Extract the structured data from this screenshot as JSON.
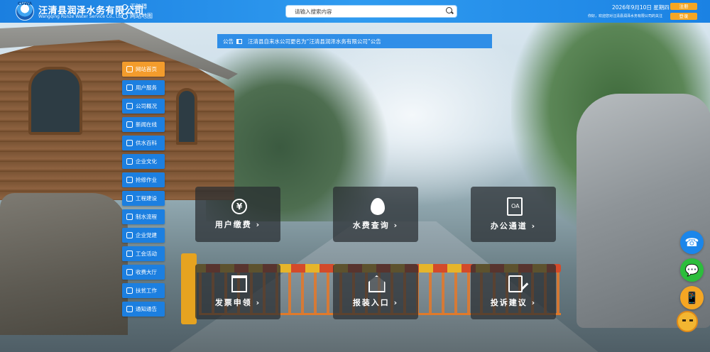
{
  "header": {
    "logo_text": "CUWA",
    "company_cn": "汪清县润泽水务有限公司",
    "company_en": "Wangqing Runze Water Service Co., Ltd",
    "link_accessible": "无障碍",
    "link_sitemap": "网站地图",
    "search_placeholder": "请输入搜索内容",
    "date": "2026年9月10日 星期四",
    "greeting": "你好，欢迎您对汪清县润泽水务有限公司的关注",
    "register_label": "注册",
    "login_label": "登录"
  },
  "notice": {
    "label": "公告",
    "text": "汪清县自来水公司更名为“汪清县润泽水务有限公司”公告"
  },
  "menu": [
    {
      "label": "网站首页",
      "active": true
    },
    {
      "label": "用户服务",
      "active": false
    },
    {
      "label": "公司概况",
      "active": false
    },
    {
      "label": "新闻在线",
      "active": false
    },
    {
      "label": "供水百科",
      "active": false
    },
    {
      "label": "企业文化",
      "active": false
    },
    {
      "label": "抢修作业",
      "active": false
    },
    {
      "label": "工程建设",
      "active": false
    },
    {
      "label": "制水流程",
      "active": false
    },
    {
      "label": "企业党建",
      "active": false
    },
    {
      "label": "工会活动",
      "active": false
    },
    {
      "label": "收费大厅",
      "active": false
    },
    {
      "label": "扶贫工作",
      "active": false
    },
    {
      "label": "通知通告",
      "active": false
    }
  ],
  "tiles": [
    {
      "label": "用户缴费 ›",
      "icon": "payment-coin-icon"
    },
    {
      "label": "水费查询 ›",
      "icon": "water-drop-search-icon"
    },
    {
      "label": "办公通道 ›",
      "icon": "oa-document-icon"
    },
    {
      "label": "发票申领 ›",
      "icon": "invoice-printer-icon"
    },
    {
      "label": "报装入口 ›",
      "icon": "house-install-icon"
    },
    {
      "label": "投诉建议 ›",
      "icon": "complaint-edit-icon"
    }
  ],
  "float_buttons": {
    "phone": "☎",
    "wechat": "💬",
    "mobile": "📱"
  },
  "colors": {
    "primary_blue": "#1c7fe0",
    "accent_orange": "#f39c2c"
  }
}
